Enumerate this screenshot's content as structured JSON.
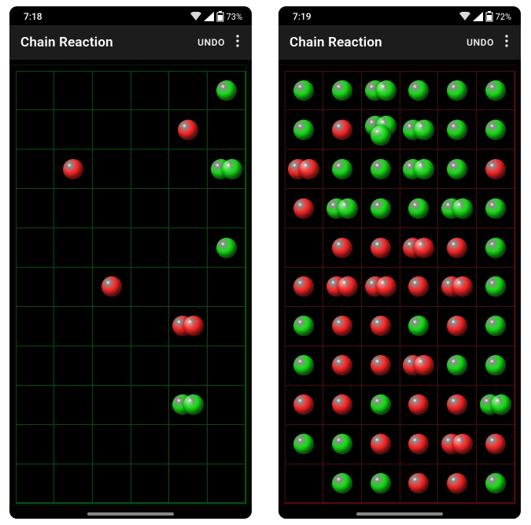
{
  "colors": {
    "green": "#18e218",
    "green_dark": "#0c7a0c",
    "red": "#ff2a2a",
    "red_dark": "#8a0d0d",
    "grid_green": "#0e4a0e",
    "grid_red": "#4a0e0e"
  },
  "screens": [
    {
      "time": "7:18",
      "battery": "73%",
      "app_title": "Chain Reaction",
      "undo_label": "UNDO",
      "grid_color_key": "grid_green",
      "cols": 6,
      "rows": 11,
      "cells": [
        {
          "row": 0,
          "col": 5,
          "orbs": [
            {
              "color": "green"
            }
          ]
        },
        {
          "row": 1,
          "col": 4,
          "orbs": [
            {
              "color": "red"
            }
          ]
        },
        {
          "row": 2,
          "col": 1,
          "orbs": [
            {
              "color": "red"
            }
          ]
        },
        {
          "row": 2,
          "col": 5,
          "orbs": [
            {
              "color": "green"
            },
            {
              "color": "green"
            }
          ]
        },
        {
          "row": 4,
          "col": 5,
          "orbs": [
            {
              "color": "green"
            }
          ]
        },
        {
          "row": 5,
          "col": 2,
          "orbs": [
            {
              "color": "red"
            }
          ]
        },
        {
          "row": 6,
          "col": 4,
          "orbs": [
            {
              "color": "red"
            },
            {
              "color": "red"
            }
          ]
        },
        {
          "row": 8,
          "col": 4,
          "orbs": [
            {
              "color": "green"
            },
            {
              "color": "green"
            }
          ]
        }
      ]
    },
    {
      "time": "7:19",
      "battery": "72%",
      "app_title": "Chain Reaction",
      "undo_label": "UNDO",
      "grid_color_key": "grid_red",
      "cols": 6,
      "rows": 11,
      "cells": [
        {
          "row": 0,
          "col": 0,
          "orbs": [
            {
              "color": "green"
            }
          ]
        },
        {
          "row": 0,
          "col": 1,
          "orbs": [
            {
              "color": "green"
            }
          ]
        },
        {
          "row": 0,
          "col": 2,
          "orbs": [
            {
              "color": "green"
            },
            {
              "color": "green"
            }
          ]
        },
        {
          "row": 0,
          "col": 3,
          "orbs": [
            {
              "color": "green"
            }
          ]
        },
        {
          "row": 0,
          "col": 4,
          "orbs": [
            {
              "color": "green"
            }
          ]
        },
        {
          "row": 0,
          "col": 5,
          "orbs": [
            {
              "color": "green"
            }
          ]
        },
        {
          "row": 1,
          "col": 0,
          "orbs": [
            {
              "color": "green"
            }
          ]
        },
        {
          "row": 1,
          "col": 1,
          "orbs": [
            {
              "color": "red"
            }
          ]
        },
        {
          "row": 1,
          "col": 2,
          "orbs": [
            {
              "color": "green"
            },
            {
              "color": "green"
            },
            {
              "color": "green"
            }
          ]
        },
        {
          "row": 1,
          "col": 3,
          "orbs": [
            {
              "color": "green"
            },
            {
              "color": "green"
            }
          ]
        },
        {
          "row": 1,
          "col": 4,
          "orbs": [
            {
              "color": "green"
            }
          ]
        },
        {
          "row": 1,
          "col": 5,
          "orbs": [
            {
              "color": "green"
            }
          ]
        },
        {
          "row": 2,
          "col": 0,
          "orbs": [
            {
              "color": "red"
            },
            {
              "color": "red"
            }
          ]
        },
        {
          "row": 2,
          "col": 1,
          "orbs": [
            {
              "color": "green"
            }
          ]
        },
        {
          "row": 2,
          "col": 2,
          "orbs": [
            {
              "color": "green"
            }
          ]
        },
        {
          "row": 2,
          "col": 3,
          "orbs": [
            {
              "color": "green"
            },
            {
              "color": "green"
            }
          ]
        },
        {
          "row": 2,
          "col": 4,
          "orbs": [
            {
              "color": "green"
            }
          ]
        },
        {
          "row": 2,
          "col": 5,
          "orbs": [
            {
              "color": "red"
            }
          ]
        },
        {
          "row": 3,
          "col": 0,
          "orbs": [
            {
              "color": "red"
            }
          ]
        },
        {
          "row": 3,
          "col": 1,
          "orbs": [
            {
              "color": "green"
            },
            {
              "color": "green"
            }
          ]
        },
        {
          "row": 3,
          "col": 2,
          "orbs": [
            {
              "color": "green"
            }
          ]
        },
        {
          "row": 3,
          "col": 3,
          "orbs": [
            {
              "color": "green"
            }
          ]
        },
        {
          "row": 3,
          "col": 4,
          "orbs": [
            {
              "color": "green"
            },
            {
              "color": "green"
            }
          ]
        },
        {
          "row": 3,
          "col": 5,
          "orbs": [
            {
              "color": "green"
            }
          ]
        },
        {
          "row": 4,
          "col": 1,
          "orbs": [
            {
              "color": "red"
            }
          ]
        },
        {
          "row": 4,
          "col": 2,
          "orbs": [
            {
              "color": "red"
            }
          ]
        },
        {
          "row": 4,
          "col": 3,
          "orbs": [
            {
              "color": "red"
            },
            {
              "color": "red"
            }
          ]
        },
        {
          "row": 4,
          "col": 4,
          "orbs": [
            {
              "color": "red"
            }
          ]
        },
        {
          "row": 4,
          "col": 5,
          "orbs": [
            {
              "color": "green"
            }
          ]
        },
        {
          "row": 5,
          "col": 0,
          "orbs": [
            {
              "color": "red"
            }
          ]
        },
        {
          "row": 5,
          "col": 1,
          "orbs": [
            {
              "color": "red"
            },
            {
              "color": "red"
            }
          ]
        },
        {
          "row": 5,
          "col": 2,
          "orbs": [
            {
              "color": "red"
            },
            {
              "color": "red"
            }
          ]
        },
        {
          "row": 5,
          "col": 3,
          "orbs": [
            {
              "color": "red"
            }
          ]
        },
        {
          "row": 5,
          "col": 4,
          "orbs": [
            {
              "color": "red"
            },
            {
              "color": "red"
            }
          ]
        },
        {
          "row": 5,
          "col": 5,
          "orbs": [
            {
              "color": "green"
            }
          ]
        },
        {
          "row": 6,
          "col": 0,
          "orbs": [
            {
              "color": "green"
            }
          ]
        },
        {
          "row": 6,
          "col": 1,
          "orbs": [
            {
              "color": "red"
            }
          ]
        },
        {
          "row": 6,
          "col": 2,
          "orbs": [
            {
              "color": "red"
            }
          ]
        },
        {
          "row": 6,
          "col": 3,
          "orbs": [
            {
              "color": "green"
            }
          ]
        },
        {
          "row": 6,
          "col": 4,
          "orbs": [
            {
              "color": "red"
            }
          ]
        },
        {
          "row": 6,
          "col": 5,
          "orbs": [
            {
              "color": "green"
            }
          ]
        },
        {
          "row": 7,
          "col": 0,
          "orbs": [
            {
              "color": "green"
            }
          ]
        },
        {
          "row": 7,
          "col": 1,
          "orbs": [
            {
              "color": "red"
            }
          ]
        },
        {
          "row": 7,
          "col": 2,
          "orbs": [
            {
              "color": "red"
            }
          ]
        },
        {
          "row": 7,
          "col": 3,
          "orbs": [
            {
              "color": "red"
            },
            {
              "color": "red"
            }
          ]
        },
        {
          "row": 7,
          "col": 4,
          "orbs": [
            {
              "color": "green"
            }
          ]
        },
        {
          "row": 7,
          "col": 5,
          "orbs": [
            {
              "color": "green"
            }
          ]
        },
        {
          "row": 8,
          "col": 0,
          "orbs": [
            {
              "color": "red"
            }
          ]
        },
        {
          "row": 8,
          "col": 1,
          "orbs": [
            {
              "color": "red"
            }
          ]
        },
        {
          "row": 8,
          "col": 2,
          "orbs": [
            {
              "color": "green"
            }
          ]
        },
        {
          "row": 8,
          "col": 3,
          "orbs": [
            {
              "color": "red"
            }
          ]
        },
        {
          "row": 8,
          "col": 4,
          "orbs": [
            {
              "color": "red"
            }
          ]
        },
        {
          "row": 8,
          "col": 5,
          "orbs": [
            {
              "color": "green"
            },
            {
              "color": "green"
            }
          ]
        },
        {
          "row": 9,
          "col": 0,
          "orbs": [
            {
              "color": "green"
            }
          ]
        },
        {
          "row": 9,
          "col": 1,
          "orbs": [
            {
              "color": "green"
            }
          ]
        },
        {
          "row": 9,
          "col": 2,
          "orbs": [
            {
              "color": "red"
            }
          ]
        },
        {
          "row": 9,
          "col": 3,
          "orbs": [
            {
              "color": "red"
            }
          ]
        },
        {
          "row": 9,
          "col": 4,
          "orbs": [
            {
              "color": "red"
            },
            {
              "color": "red"
            }
          ]
        },
        {
          "row": 9,
          "col": 5,
          "orbs": [
            {
              "color": "red"
            }
          ]
        },
        {
          "row": 10,
          "col": 1,
          "orbs": [
            {
              "color": "green"
            }
          ]
        },
        {
          "row": 10,
          "col": 2,
          "orbs": [
            {
              "color": "green"
            }
          ]
        },
        {
          "row": 10,
          "col": 3,
          "orbs": [
            {
              "color": "red"
            }
          ]
        },
        {
          "row": 10,
          "col": 4,
          "orbs": [
            {
              "color": "red"
            }
          ]
        },
        {
          "row": 10,
          "col": 5,
          "orbs": [
            {
              "color": "green"
            }
          ]
        }
      ]
    }
  ]
}
